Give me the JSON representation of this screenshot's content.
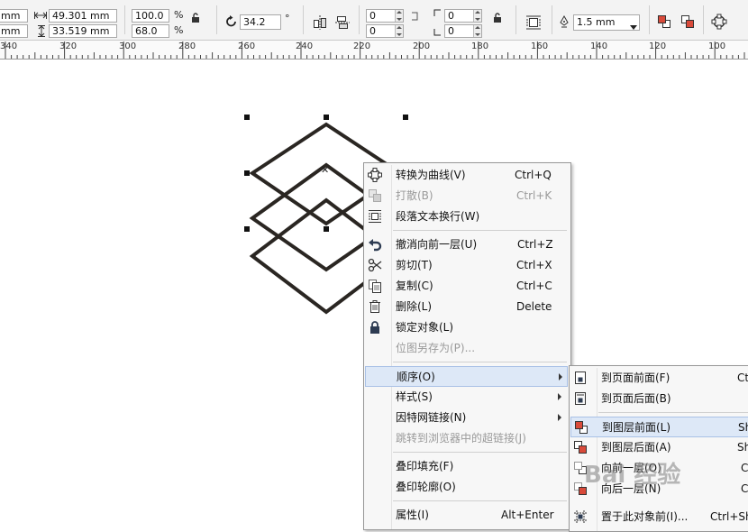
{
  "propbar": {
    "x_unit": "mm",
    "y_unit": "mm",
    "width_value": "49.301 mm",
    "height_value": "33.519 mm",
    "scale_x": "100.0",
    "scale_y": "68.0",
    "percent_sign": "%",
    "rotation": "34.2",
    "degree_sign": "°",
    "skew_a": "0",
    "skew_b": "0",
    "corner_a": "0",
    "corner_b": "0",
    "outline_width": "1.5 mm"
  },
  "ruler": {
    "labels": [
      "340",
      "320",
      "300",
      "280",
      "260",
      "240",
      "220",
      "200",
      "180",
      "160",
      "140",
      "120",
      "100"
    ]
  },
  "context_menu": {
    "items": [
      {
        "label": "转换为曲线(V)",
        "shortcut": "Ctrl+Q",
        "icon": "convert-curve-icon",
        "enabled": true
      },
      {
        "label": "打散(B)",
        "shortcut": "Ctrl+K",
        "icon": "break-apart-icon",
        "enabled": false
      },
      {
        "label": "段落文本换行(W)",
        "shortcut": "",
        "icon": "text-wrap-icon",
        "enabled": true
      },
      {
        "label": "撤消向前一层(U)",
        "shortcut": "Ctrl+Z",
        "icon": "undo-icon",
        "enabled": true
      },
      {
        "label": "剪切(T)",
        "shortcut": "Ctrl+X",
        "icon": "scissors-icon",
        "enabled": true
      },
      {
        "label": "复制(C)",
        "shortcut": "Ctrl+C",
        "icon": "copy-icon",
        "enabled": true
      },
      {
        "label": "删除(L)",
        "shortcut": "Delete",
        "icon": "trash-icon",
        "enabled": true
      },
      {
        "label": "锁定对象(L)",
        "shortcut": "",
        "icon": "lock-icon",
        "enabled": true
      },
      {
        "label": "位图另存为(P)...",
        "shortcut": "",
        "icon": "",
        "enabled": false
      },
      {
        "label": "顺序(O)",
        "shortcut": "",
        "icon": "",
        "enabled": true,
        "submenu": true,
        "highlighted": true
      },
      {
        "label": "样式(S)",
        "shortcut": "",
        "icon": "",
        "enabled": true,
        "submenu": true
      },
      {
        "label": "因特网链接(N)",
        "shortcut": "",
        "icon": "",
        "enabled": true,
        "submenu": true
      },
      {
        "label": "跳转到浏览器中的超链接(J)",
        "shortcut": "",
        "icon": "",
        "enabled": false
      },
      {
        "label": "叠印填充(F)",
        "shortcut": "",
        "icon": "",
        "enabled": true
      },
      {
        "label": "叠印轮廓(O)",
        "shortcut": "",
        "icon": "",
        "enabled": true
      },
      {
        "label": "属性(I)",
        "shortcut": "Alt+Enter",
        "icon": "",
        "enabled": true
      }
    ]
  },
  "order_submenu": {
    "items": [
      {
        "label": "到页面前面(F)",
        "shortcut": "Ct",
        "icon": "to-page-front-icon"
      },
      {
        "label": "到页面后面(B)",
        "shortcut": "",
        "icon": "to-page-back-icon"
      },
      {
        "label": "到图层前面(L)",
        "shortcut": "Sh",
        "icon": "to-layer-front-icon",
        "highlighted": true
      },
      {
        "label": "到图层后面(A)",
        "shortcut": "Sh",
        "icon": "to-layer-back-icon"
      },
      {
        "label": "向前一层(O)",
        "shortcut": "C",
        "icon": "forward-one-icon"
      },
      {
        "label": "向后一层(N)",
        "shortcut": "C",
        "icon": "back-one-icon"
      },
      {
        "label": "置于此对象前(I)...",
        "shortcut": "Ctrl+Sh",
        "icon": "in-front-of-icon"
      }
    ]
  },
  "watermark": {
    "text": "Bai 经验"
  },
  "colors": {
    "menu_highlight": "#dde8f7",
    "menu_bg": "#f7f7f7",
    "shape_stroke": "#2a2622"
  }
}
